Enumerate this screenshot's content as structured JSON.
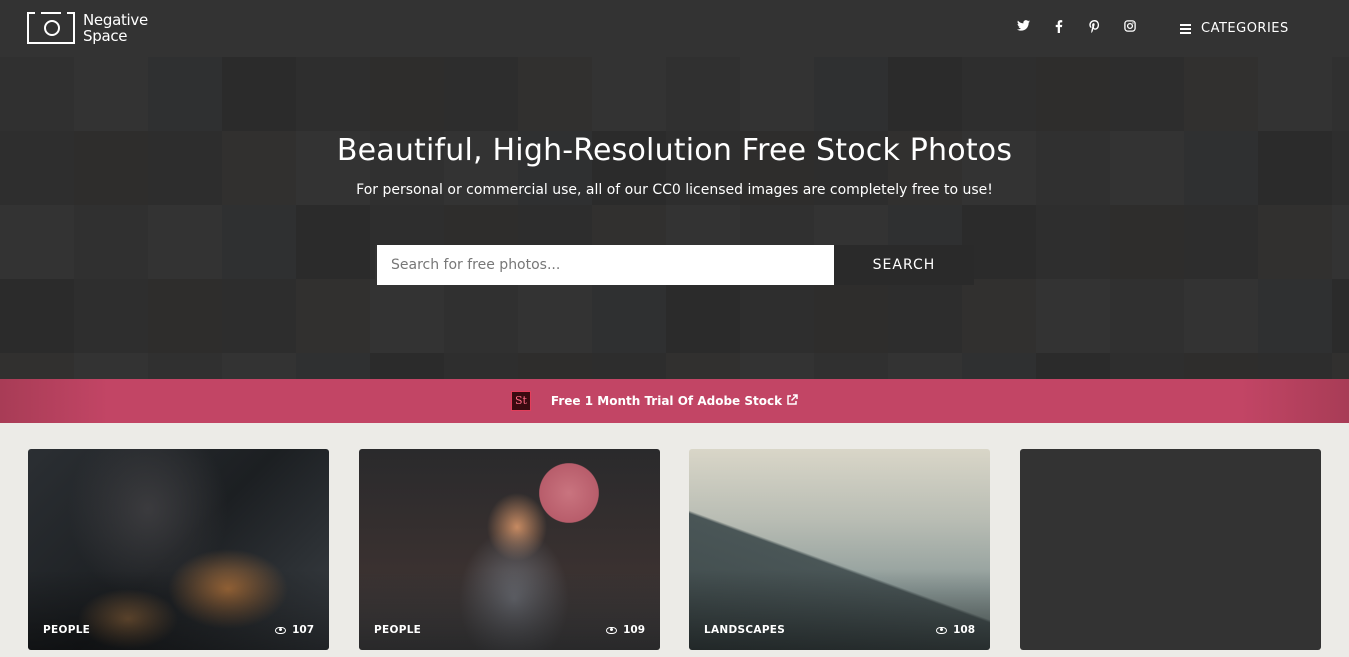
{
  "header": {
    "logo_line1": "Negative",
    "logo_line2": "Space",
    "social": [
      {
        "name": "twitter-icon",
        "glyph": "🐦"
      },
      {
        "name": "facebook-icon",
        "glyph": "f"
      },
      {
        "name": "pinterest-icon",
        "glyph": "p"
      },
      {
        "name": "instagram-icon",
        "glyph": "◎"
      }
    ],
    "categories_label": "CATEGORIES"
  },
  "hero": {
    "title": "Beautiful, High-Resolution Free Stock Photos",
    "subtitle": "For personal or commercial use, all of our CC0 licensed images are completely free to use!",
    "search_placeholder": "Search for free photos...",
    "search_value": "",
    "search_button": "SEARCH"
  },
  "promo": {
    "badge": "St",
    "text": "Free 1 Month Trial Of Adobe Stock",
    "external_icon": "↗"
  },
  "cards": [
    {
      "category": "PEOPLE",
      "views": "107"
    },
    {
      "category": "PEOPLE",
      "views": "109"
    },
    {
      "category": "LANDSCAPES",
      "views": "108"
    },
    {
      "category": "",
      "views": ""
    }
  ],
  "colors": {
    "header_bg": "#333333",
    "promo_bg": "#c24565",
    "page_bg": "#ecebe7",
    "search_button_bg": "#2a2a2a"
  }
}
